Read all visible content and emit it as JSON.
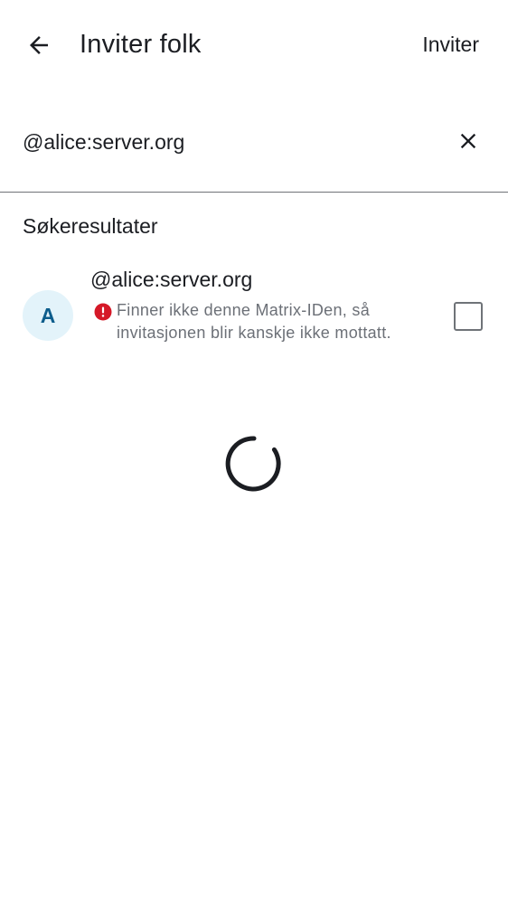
{
  "topbar": {
    "title": "Inviter folk",
    "invite_label": "Inviter",
    "back_icon": "arrow-back-icon"
  },
  "search": {
    "value": "@alice:server.org",
    "clear_icon": "close-icon"
  },
  "results": {
    "section_title": "Søkeresultater",
    "items": [
      {
        "avatar_initial": "A",
        "name": "@alice:server.org",
        "warning_icon": "error-icon",
        "warning": "Finner ikke denne Matrix-IDen, så invitasjonen blir kanskje ikke mottatt.",
        "selected": false
      }
    ]
  },
  "loading": {
    "icon": "loading-spinner-icon"
  },
  "colors": {
    "text_primary": "#1b1d22",
    "text_secondary": "#6c7077",
    "avatar_bg": "#e3f3fa",
    "avatar_text": "#0d5d8c",
    "error": "#d51928",
    "divider": "#6f7378"
  }
}
